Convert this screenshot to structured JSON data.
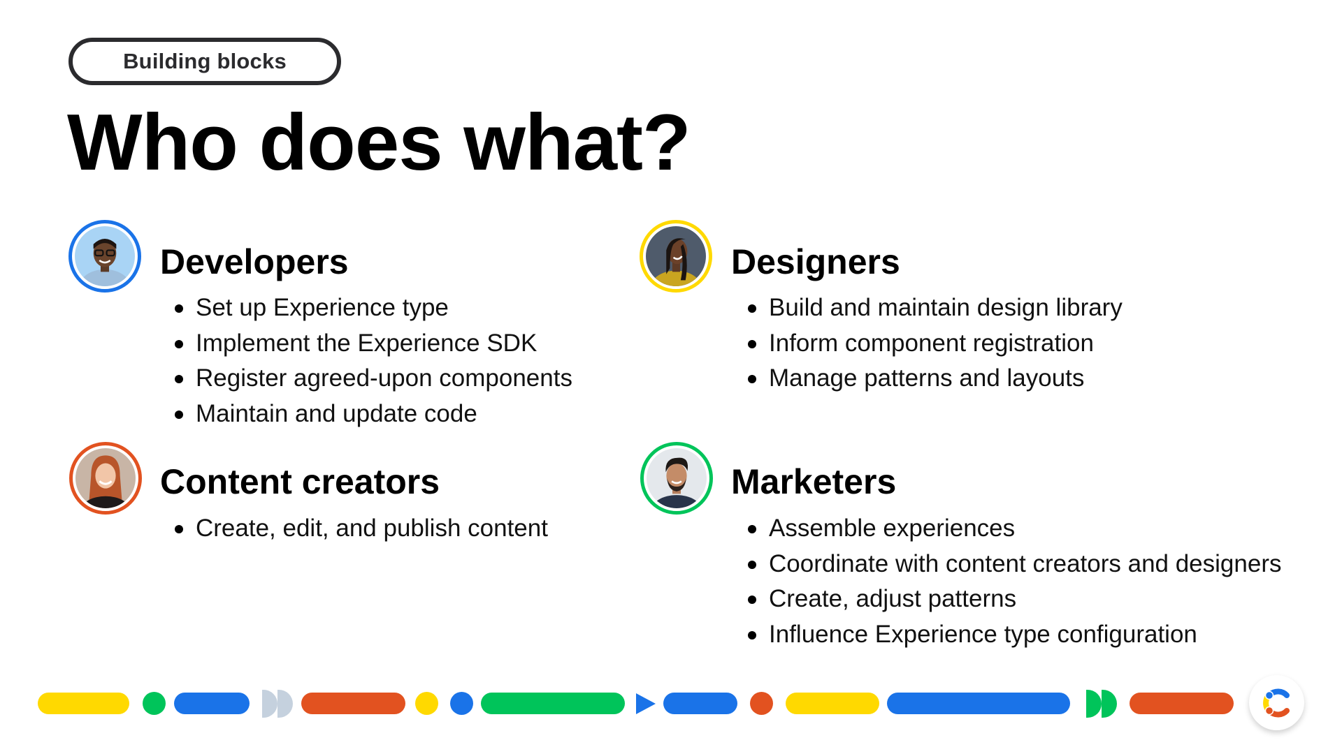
{
  "tag": {
    "label": "Building blocks"
  },
  "title": "Who does what?",
  "colors": {
    "blue": "#1a73e8",
    "yellow": "#ffd900",
    "orange": "#e25220",
    "green": "#00c45a",
    "grey": "#c5d1de",
    "text": "#000000",
    "pill_border": "#2b2b2e"
  },
  "roles": [
    {
      "name": "Developers",
      "ring_color": "#1a73e8",
      "avatar": "developer-avatar",
      "items": [
        "Set up Experience type",
        "Implement the Experience SDK",
        "Register agreed-upon components",
        "Maintain and update code"
      ]
    },
    {
      "name": "Designers",
      "ring_color": "#ffd900",
      "avatar": "designer-avatar",
      "items": [
        "Build and maintain design library",
        "Inform component registration",
        "Manage patterns and layouts"
      ]
    },
    {
      "name": "Content creators",
      "ring_color": "#e25220",
      "avatar": "content-creator-avatar",
      "items": [
        "Create, edit, and publish content"
      ]
    },
    {
      "name": "Marketers",
      "ring_color": "#00c45a",
      "avatar": "marketer-avatar",
      "items": [
        "Assemble experiences",
        "Coordinate with content creators and designers",
        "Create, adjust patterns",
        "Influence Experience type configuration"
      ]
    }
  ],
  "footer": {
    "logo": "contentful-logo-icon"
  }
}
